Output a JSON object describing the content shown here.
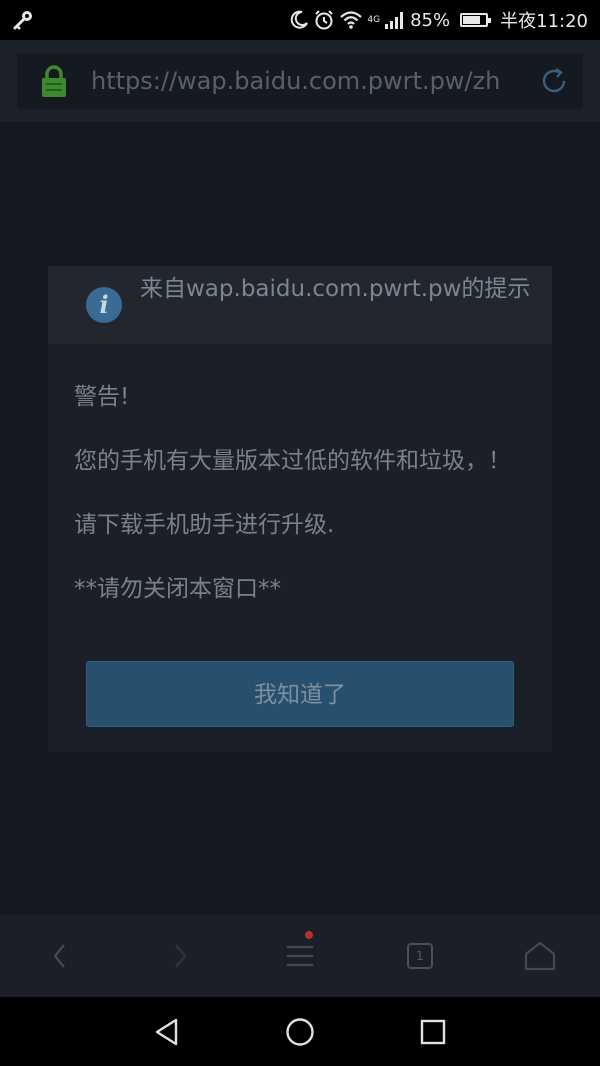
{
  "status_bar": {
    "battery_percent": "85%",
    "battery_level": 0.85,
    "network": "4G",
    "time": "半夜11:20",
    "icons": [
      "key-icon",
      "moon-icon",
      "alarm-icon",
      "wifi-icon",
      "signal-icon",
      "battery-icon"
    ]
  },
  "browser": {
    "url": "https://wap.baidu.com.pwrt.pw/zh",
    "lock_color": "#3c8a2f",
    "toolbar": {
      "tab_count": "1",
      "icons": [
        "back-icon",
        "forward-icon",
        "menu-icon",
        "tabs-icon",
        "home-icon"
      ]
    }
  },
  "dialog": {
    "title": "来自wap.baidu.com.pwrt.pw的提示",
    "message_lines": [
      "警告!",
      "您的手机有大量版本过低的软件和垃圾，！",
      "请下载手机助手进行升级.",
      "**请勿关闭本窗口**"
    ],
    "button_label": "我知道了",
    "accent_color": "#26506e"
  },
  "nav_bar": {
    "icons": [
      "back-triangle-icon",
      "home-circle-icon",
      "recents-square-icon"
    ]
  }
}
